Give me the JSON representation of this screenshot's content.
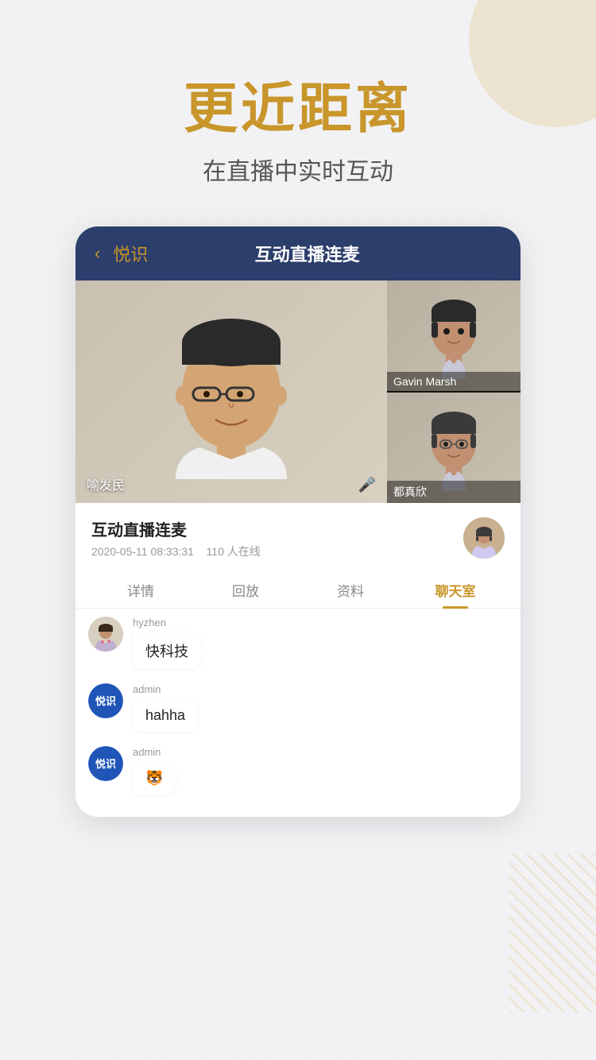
{
  "background": {
    "dotColor": "#c8c8c8"
  },
  "header": {
    "mainTitle": "更近距离",
    "subTitle": "在直播中实时互动"
  },
  "phoneCard": {
    "nav": {
      "backIcon": "‹",
      "appName": "悦识",
      "title": "互动直播连麦"
    },
    "videoGrid": {
      "mainSpeaker": {
        "label": "喻发民",
        "hasMic": true
      },
      "smallSpeakers": [
        {
          "label": "Gavin Marsh"
        },
        {
          "label": "都真欣"
        }
      ]
    },
    "info": {
      "title": "互动直播连麦",
      "date": "2020-05-11 08:33:31",
      "online": "110 人在线"
    },
    "tabs": [
      {
        "label": "详情",
        "active": false
      },
      {
        "label": "回放",
        "active": false
      },
      {
        "label": "资料",
        "active": false
      },
      {
        "label": "聊天室",
        "active": true
      }
    ],
    "chatMessages": [
      {
        "username": "hyzhen",
        "message": "快科技",
        "avatarType": "photo"
      },
      {
        "username": "admin",
        "message": "hahha",
        "avatarType": "badge",
        "badgeText": "悦识"
      },
      {
        "username": "admin",
        "message": "🐯",
        "avatarType": "badge",
        "badgeText": "悦识"
      }
    ]
  }
}
